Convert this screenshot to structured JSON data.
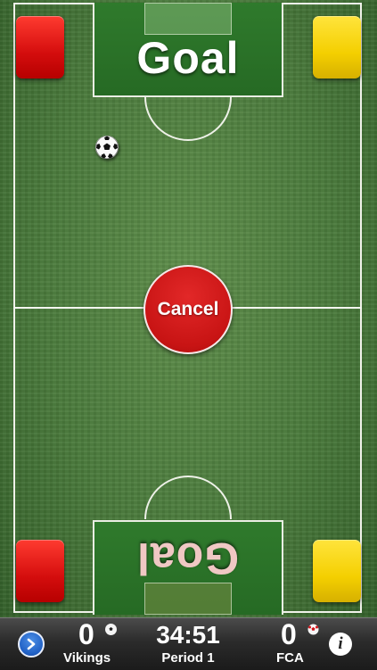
{
  "pitch": {
    "top_goal_label": "Goal",
    "bottom_goal_label": "Goal",
    "cancel_label": "Cancel"
  },
  "cards": {
    "colors": {
      "red": "#e01414",
      "yellow": "#f4cf00"
    }
  },
  "scoreboard": {
    "home": {
      "score": "0",
      "name": "Vikings"
    },
    "away": {
      "score": "0",
      "name": "FCA"
    },
    "clock": "34:51",
    "period": "Period 1"
  },
  "icons": {
    "nav": "chevron-right-icon",
    "info": "info-icon",
    "ball": "soccer-ball-icon"
  }
}
